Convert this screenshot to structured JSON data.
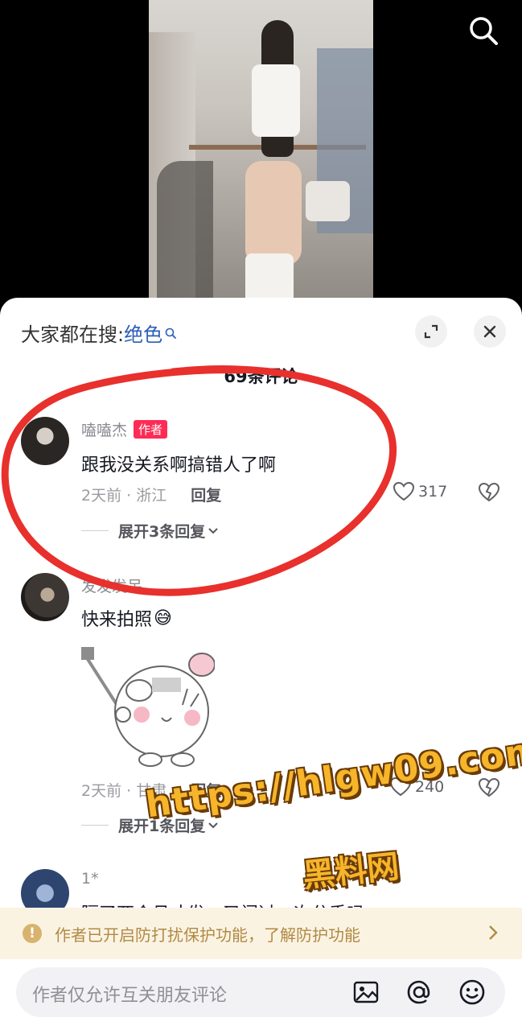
{
  "video": {
    "search_icon": "search-icon"
  },
  "sheet": {
    "hot_search_prefix": "大家都在搜:",
    "hot_search_keyword": "绝色",
    "expand_icon": "expand-icon",
    "close_icon": "close-icon",
    "comment_count": "69条评论"
  },
  "comments": [
    {
      "username": "嗑嗑杰",
      "badge": "作者",
      "text": "跟我没关系啊搞错人了啊",
      "time_location": "2天前 · 浙江",
      "reply_label": "回复",
      "likes": "317",
      "expand_label": "展开3条回复"
    },
    {
      "username": "发发发呆",
      "text": "快来拍照",
      "emoji": "😅",
      "time_location": "2天前 · 甘肃",
      "reply_label": "回复",
      "likes": "240",
      "expand_label": "展开1条回复"
    },
    {
      "username": "1*",
      "text": "隔了两个月才发，又闷过一次分手吗"
    }
  ],
  "watermark": {
    "url": "https://hlgw09.com",
    "name": "黑料网"
  },
  "notice": {
    "text": "作者已开启防打扰保护功能，了解防护功能"
  },
  "input": {
    "placeholder": "作者仅允许互关朋友评论"
  },
  "colors": {
    "accent_red": "#fe2c55",
    "link_blue": "#2b5eb8",
    "notice_bg": "#fbf3e2",
    "annotation_red": "#e8302c",
    "watermark_gold": "#f6b52a"
  }
}
